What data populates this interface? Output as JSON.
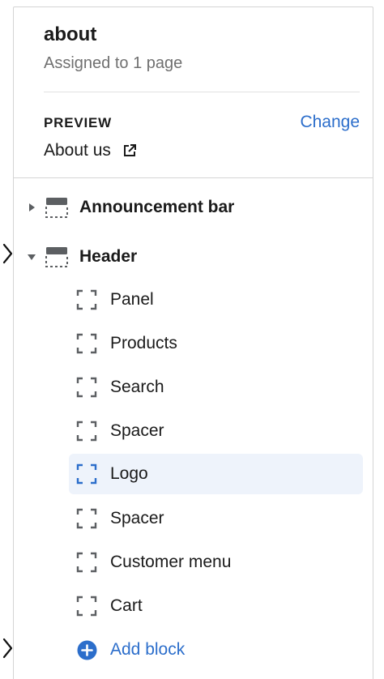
{
  "page": {
    "title": "about",
    "subtitle": "Assigned to 1 page"
  },
  "preview": {
    "label": "PREVIEW",
    "change_label": "Change",
    "page_name": "About us"
  },
  "sections": [
    {
      "label": "Announcement bar",
      "expanded": false
    },
    {
      "label": "Header",
      "expanded": true
    }
  ],
  "blocks": [
    {
      "label": "Panel"
    },
    {
      "label": "Products"
    },
    {
      "label": "Search"
    },
    {
      "label": "Spacer"
    },
    {
      "label": "Logo",
      "selected": true
    },
    {
      "label": "Spacer"
    },
    {
      "label": "Customer menu"
    },
    {
      "label": "Cart"
    }
  ],
  "add_block": {
    "label": "Add block"
  },
  "colors": {
    "accent": "#2c6ecb",
    "selected_bg": "#eef3fb",
    "muted_text": "#707070",
    "icon": "#5c5f62"
  },
  "icons": {
    "external_link": "external-link-icon",
    "section": "section-layout-icon",
    "block": "block-dashed-icon",
    "add": "plus-circle-icon"
  }
}
